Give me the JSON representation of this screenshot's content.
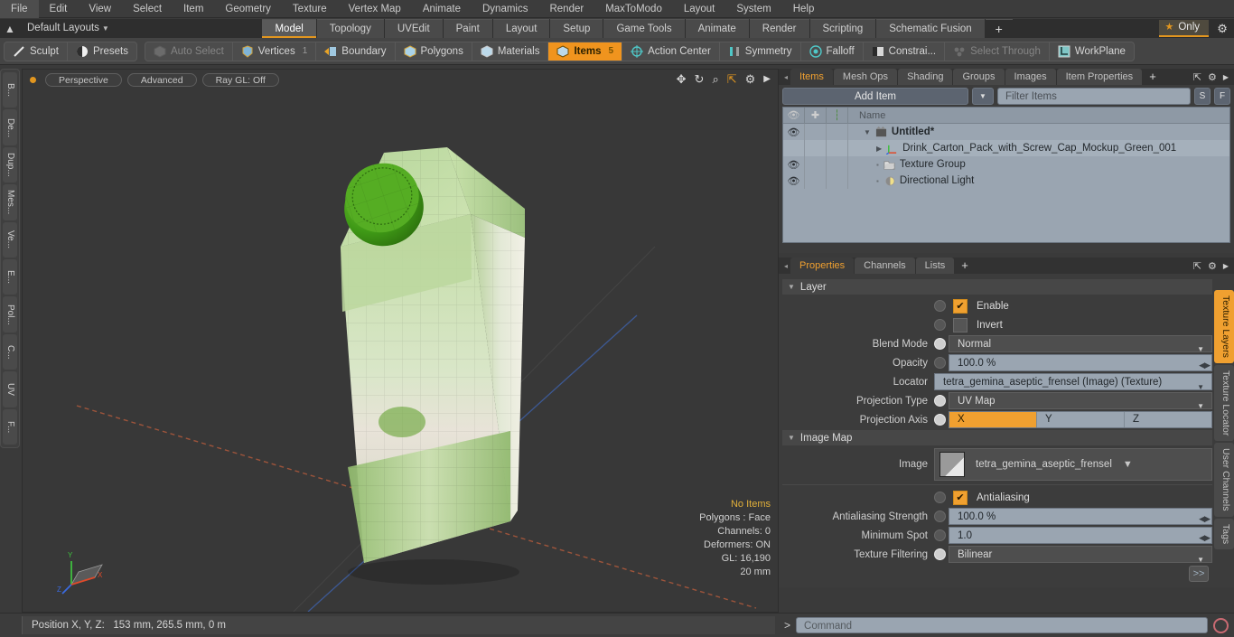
{
  "menubar": {
    "items": [
      "File",
      "Edit",
      "View",
      "Select",
      "Item",
      "Geometry",
      "Texture",
      "Vertex Map",
      "Animate",
      "Dynamics",
      "Render",
      "MaxToModo",
      "Layout",
      "System",
      "Help"
    ]
  },
  "layoutbar": {
    "home_icon": "home-icon",
    "layout_selector": "Default Layouts",
    "tabs": [
      "Model",
      "Topology",
      "UVEdit",
      "Paint",
      "Layout",
      "Setup",
      "Game Tools",
      "Animate",
      "Render",
      "Scripting",
      "Schematic Fusion"
    ],
    "selected_tab": "Model",
    "add_tab_label": "+",
    "only_label": "Only",
    "gear_icon": "gear-icon"
  },
  "toolbar": {
    "groups": [
      {
        "buttons": [
          {
            "label": "Sculpt",
            "icon": "sculpt-icon",
            "state": "normal",
            "count": ""
          },
          {
            "label": "Presets",
            "icon": "presets-icon",
            "state": "normal",
            "count": ""
          }
        ]
      },
      {
        "buttons": [
          {
            "label": "Auto Select",
            "icon": "cube-icon",
            "state": "dim",
            "count": ""
          },
          {
            "label": "Vertices",
            "icon": "vertices-icon",
            "state": "normal",
            "count": "1"
          },
          {
            "label": "Boundary",
            "icon": "boundary-icon",
            "state": "normal",
            "count": ""
          },
          {
            "label": "Polygons",
            "icon": "polygons-icon",
            "state": "normal",
            "count": ""
          },
          {
            "label": "Materials",
            "icon": "materials-icon",
            "state": "normal",
            "count": ""
          },
          {
            "label": "Items",
            "icon": "items-icon",
            "state": "active",
            "count": "5"
          },
          {
            "label": "Action Center",
            "icon": "action-center-icon",
            "state": "normal",
            "count": ""
          },
          {
            "label": "Symmetry",
            "icon": "symmetry-icon",
            "state": "normal",
            "count": ""
          },
          {
            "label": "Falloff",
            "icon": "falloff-icon",
            "state": "normal",
            "count": ""
          },
          {
            "label": "Constrai...",
            "icon": "constraint-icon",
            "state": "normal",
            "count": ""
          },
          {
            "label": "Select Through",
            "icon": "select-through-icon",
            "state": "dim",
            "count": ""
          },
          {
            "label": "WorkPlane",
            "icon": "workplane-icon",
            "state": "normal",
            "count": ""
          }
        ]
      }
    ]
  },
  "left_tabs": [
    "B...",
    "De...",
    "Dup...",
    "Mes...",
    "Ve...",
    "E...",
    "Pol...",
    "C...",
    "UV",
    "F..."
  ],
  "viewport": {
    "mode_label": "Perspective",
    "shading_label": "Advanced",
    "raygl_label": "Ray GL: Off",
    "control_icons": [
      "move-icon",
      "rotate-icon",
      "zoom-icon",
      "fit-icon",
      "settings-icon",
      "play-icon"
    ],
    "stats": {
      "selection": "No Items",
      "polygons": "Polygons : Face",
      "channels": "Channels: 0",
      "deformers": "Deformers: ON",
      "gl": "GL: 16,190",
      "scale": "20 mm"
    },
    "gizmo_axes": [
      "X",
      "Y",
      "Z"
    ]
  },
  "statusbar": {
    "position_label": "Position X, Y, Z:",
    "position_value": "153 mm, 265.5 mm, 0 m"
  },
  "items_panel": {
    "tabs": [
      "Items",
      "Mesh Ops",
      "Shading",
      "Groups",
      "Images",
      "Item Properties"
    ],
    "selected_tab": "Items",
    "add_tab_label": "+",
    "expand_icon": "expand-icon",
    "gear_icon": "gear-icon",
    "more_icon": "chevron-right-icon",
    "add_item_label": "Add Item",
    "filter_placeholder": "Filter Items",
    "s_button": "S",
    "f_button": "F",
    "columns": [
      "eye-icon",
      "lock-icon",
      "axis-icon",
      "Name"
    ],
    "rows": [
      {
        "name": "Untitled*",
        "icon": "scene-icon",
        "indent": 0,
        "bold": true,
        "eye": true,
        "expander": "down",
        "selected": false
      },
      {
        "name": "Drink_Carton_Pack_with_Screw_Cap_Mockup_Green_001",
        "icon": "mesh-icon",
        "indent": 1,
        "bold": false,
        "eye": false,
        "expander": "right",
        "selected": true
      },
      {
        "name": "Texture Group",
        "icon": "folder-icon",
        "indent": 1,
        "bold": false,
        "eye": true,
        "expander": "none",
        "selected": false
      },
      {
        "name": "Directional Light",
        "icon": "light-icon",
        "indent": 1,
        "bold": false,
        "eye": true,
        "expander": "none",
        "selected": false
      }
    ]
  },
  "properties_panel": {
    "tabs": [
      "Properties",
      "Channels",
      "Lists"
    ],
    "selected_tab": "Properties",
    "add_tab_label": "+",
    "expand_icon": "expand-icon",
    "gear_icon": "gear-icon",
    "more_icon": "chevron-right-icon",
    "sections": [
      {
        "title": "Layer",
        "rows": [
          {
            "type": "checkbox",
            "label": "",
            "text": "Enable",
            "checked": true,
            "knob": false
          },
          {
            "type": "checkbox",
            "label": "",
            "text": "Invert",
            "checked": false,
            "knob": false
          },
          {
            "type": "dropdown",
            "label": "Blend Mode",
            "value": "Normal",
            "knob": true,
            "dark": true
          },
          {
            "type": "slider",
            "label": "Opacity",
            "value": "100.0 %",
            "knob": true
          },
          {
            "type": "dropdown",
            "label": "Locator",
            "value": "tetra_gemina_aseptic_frensel (Image) (Texture)",
            "knob": false,
            "dark": false
          },
          {
            "type": "dropdown",
            "label": "Projection Type",
            "value": "UV Map",
            "knob": true,
            "dark": true
          },
          {
            "type": "segmented",
            "label": "Projection Axis",
            "options": [
              "X",
              "Y",
              "Z"
            ],
            "selected": "X",
            "knob": true
          }
        ]
      },
      {
        "title": "Image Map",
        "rows": [
          {
            "type": "image",
            "label": "Image",
            "value": "tetra_gemina_aseptic_frensel",
            "thumb": "texture-thumbnail"
          },
          {
            "type": "divider"
          },
          {
            "type": "checkbox",
            "label": "",
            "text": "Antialiasing",
            "checked": true,
            "knob": false
          },
          {
            "type": "slider",
            "label": "Antialiasing Strength",
            "value": "100.0 %",
            "knob": true
          },
          {
            "type": "slider",
            "label": "Minimum Spot",
            "value": "1.0",
            "knob": true
          },
          {
            "type": "dropdown",
            "label": "Texture Filtering",
            "value": "Bilinear",
            "knob": true,
            "dark": true
          }
        ]
      }
    ],
    "more_button": ">>"
  },
  "right_tabs": [
    {
      "label": "Texture Layers",
      "selected": true
    },
    {
      "label": "Texture Locator",
      "selected": false
    },
    {
      "label": "User Channels",
      "selected": false
    },
    {
      "label": "Tags",
      "selected": false
    }
  ],
  "command_bar": {
    "prompt": ">",
    "placeholder": "Command",
    "record_icon": "record-icon"
  },
  "colors": {
    "accent": "#f0a030",
    "panel_bg": "#3c3c3c",
    "field_bg": "#9aa5b1",
    "viewport_bg": "#383838",
    "carton_green": "#a8d08a",
    "cap_green": "#4aa81e"
  }
}
